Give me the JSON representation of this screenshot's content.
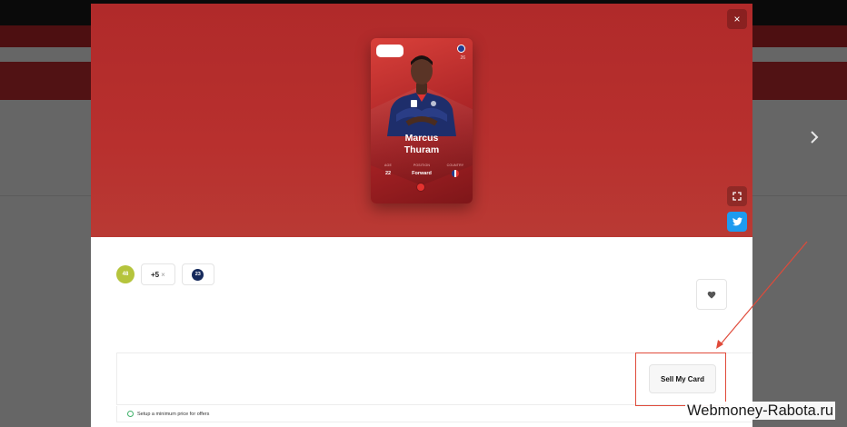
{
  "player": {
    "first_name": "Marcus",
    "last_name": "Thuram",
    "card_number": "26",
    "age_label": "AGE",
    "age": "22",
    "position_label": "POSITION",
    "position": "Forward",
    "country_label": "COUNTRY",
    "country_flag_colors": [
      "#1f3d91",
      "#ffffff",
      "#e4322f"
    ]
  },
  "chips": {
    "level": "48",
    "bonus": "+5",
    "bonus_suffix": "×",
    "club_number": "23"
  },
  "actions": {
    "close_label": "×",
    "sell_label": "Sell My Card",
    "min_price_text": "Setup a minimum price for offers"
  },
  "watermark": "Webmoney-Rabota.ru",
  "colors": {
    "hero": "#b02a2a",
    "card": "#c7302f",
    "twitter": "#1d9bf0",
    "level_chip": "#b5c43c",
    "annotation": "#e04a3a"
  }
}
